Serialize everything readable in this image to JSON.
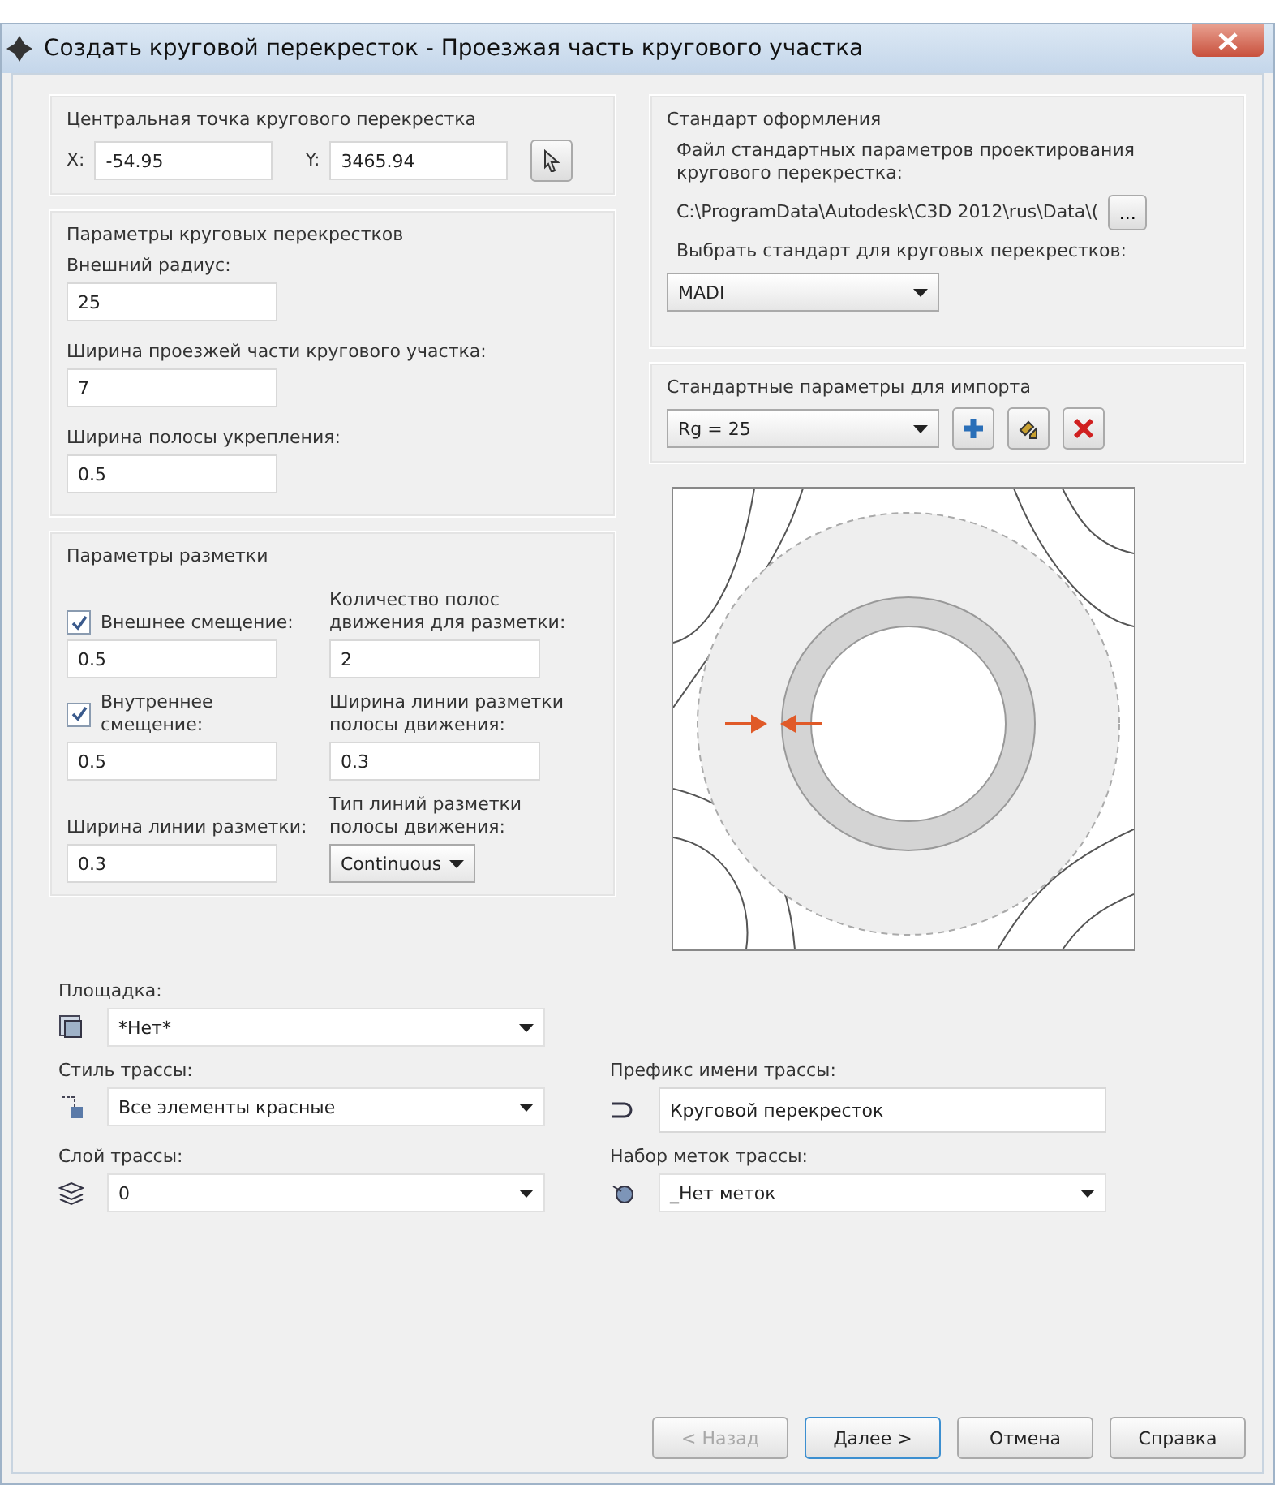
{
  "window": {
    "title": "Создать круговой перекресток - Проезжая часть кругового участка"
  },
  "center_point": {
    "title": "Центральная точка кругового перекрестка",
    "x_label": "X:",
    "x_value": "-54.95",
    "y_label": "Y:",
    "y_value": "3465.94"
  },
  "roundabout_params": {
    "title": "Параметры круговых перекрестков",
    "fields": [
      {
        "label": "Внешний радиус:",
        "value": "25"
      },
      {
        "label": "Ширина проезжей части кругового участка:",
        "value": "7"
      },
      {
        "label": "Ширина полосы укрепления:",
        "value": "0.5"
      }
    ]
  },
  "marking": {
    "title": "Параметры разметки",
    "left": [
      {
        "kind": "checkbox",
        "label": "Внешнее смещение:",
        "checked": true,
        "value": "0.5"
      },
      {
        "kind": "checkbox",
        "label": "Внутреннее смещение:",
        "checked": true,
        "value": "0.5"
      },
      {
        "kind": "text",
        "label": "Ширина линии разметки:",
        "value": "0.3"
      }
    ],
    "right": [
      {
        "kind": "text",
        "label": "Количество полос движения для разметки:",
        "value": "2"
      },
      {
        "kind": "text",
        "label": "Ширина линии разметки полосы движения:",
        "value": "0.3"
      },
      {
        "kind": "dropdown",
        "label": "Тип линий разметки полосы движения:",
        "value": "Continuous"
      }
    ]
  },
  "standard": {
    "title": "Стандарт оформления",
    "file_label": "Файл стандартных параметров проектирования кругового перекрестка:",
    "file_path": "C:\\ProgramData\\Autodesk\\C3D 2012\\rus\\Data\\(",
    "browse": "...",
    "select_label": "Выбрать стандарт для круговых перекрестков:",
    "select_value": "MADI"
  },
  "import": {
    "title": "Стандартные параметры для импорта",
    "value": "Rg = 25"
  },
  "alignment": {
    "left": [
      {
        "kind": "dropdown",
        "label": "Площадка:",
        "value": "*Нет*"
      },
      {
        "kind": "dropdown",
        "label": "Стиль трассы:",
        "value": "Все элементы красные"
      },
      {
        "kind": "dropdown",
        "label": "Слой трассы:",
        "value": "0"
      }
    ],
    "right": [
      {
        "kind": "text",
        "label": "Префикс имени трассы:",
        "value": "Круговой перекресток"
      },
      {
        "kind": "dropdown",
        "label": "Набор меток трассы:",
        "value": "_Нет меток"
      }
    ]
  },
  "buttons": [
    {
      "label": "< Назад",
      "disabled": true,
      "default": false
    },
    {
      "label": "Далее >",
      "disabled": false,
      "default": true
    },
    {
      "label": "Отмена",
      "disabled": false,
      "default": false
    },
    {
      "label": "Справка",
      "disabled": false,
      "default": false
    }
  ]
}
